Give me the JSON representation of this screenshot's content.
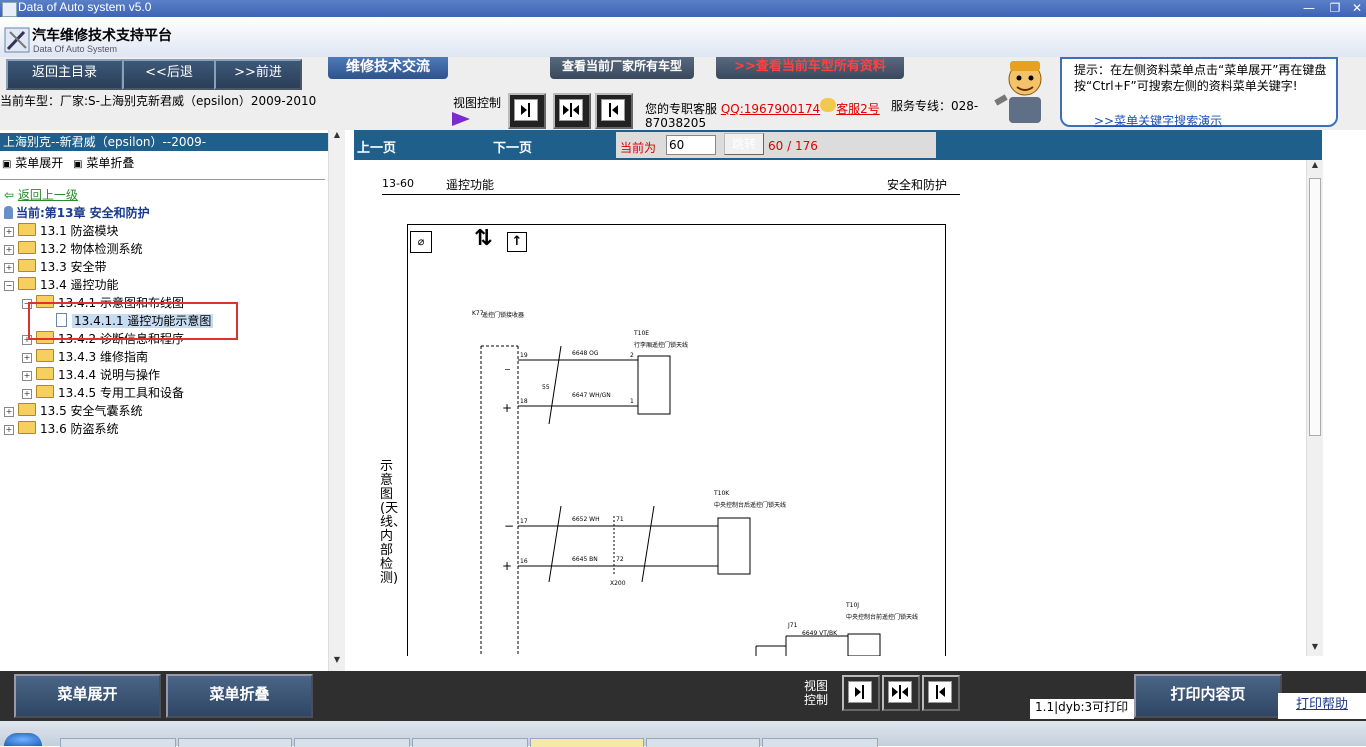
{
  "window": {
    "title": "Data of Auto system v5.0"
  },
  "header": {
    "title": "汽车维修技术支持平台",
    "subtitle": "Data Of Auto System"
  },
  "nav": {
    "back_home": "返回主目录",
    "back": "<<后退",
    "forward": ">>前进",
    "tech_exchange": "维修技术交流",
    "view_brand_models": "查看当前厂家所有车型",
    "view_model_data": ">>查看当前车型所有资料",
    "current_model": "当前车型：厂家:S-上海别克新君威（epsilon）2009-2010",
    "view_control": "视图控制",
    "service_label": "您的专职客服",
    "qq": "QQ:1967900174",
    "service2": "客服2号",
    "hotline": "服务专线：028-87038205",
    "tip": "提示：在左侧资料菜单点击“菜单展开”再在键盘按“Ctrl+F”可搜索左侧的资料菜单关键字!",
    "tip_link": ">>菜单关键字搜索演示"
  },
  "left": {
    "header": "上海别克--新君威（epsilon）--2009-",
    "expand": "菜单展开",
    "collapse": "菜单折叠",
    "back_up": "返回上一级",
    "current": "当前:第13章 安全和防护",
    "tree": [
      {
        "label": "13.1 防盗模块",
        "indent": 0
      },
      {
        "label": "13.2 物体检测系统",
        "indent": 0
      },
      {
        "label": "13.3 安全带",
        "indent": 0
      },
      {
        "label": "13.4 遥控功能",
        "indent": 0
      },
      {
        "label": "13.4.1 示意图和布线图",
        "indent": 1
      },
      {
        "label": "13.4.1.1 遥控功能示意图",
        "indent": 2
      },
      {
        "label": "13.4.2 诊断信息和程序",
        "indent": 1
      },
      {
        "label": "13.4.3 维修指南",
        "indent": 1
      },
      {
        "label": "13.4.4 说明与操作",
        "indent": 1
      },
      {
        "label": "13.4.5 专用工具和设备",
        "indent": 1
      },
      {
        "label": "13.5 安全气囊系统",
        "indent": 0
      },
      {
        "label": "13.6 防盗系统",
        "indent": 0
      }
    ]
  },
  "main": {
    "prev": "上一页",
    "next": "下一页",
    "current_label": "当前为",
    "page_value": "60",
    "jump": "跳转",
    "page_count": "60 / 176",
    "doc_page": "13-60",
    "doc_section": "遥控功能",
    "doc_chapter": "安全和防护",
    "doc_side_title": "示意图(天线、内部检测)",
    "diagram": {
      "conn_top": "K77",
      "conn_top_desc": "遥控门锁接收器",
      "t10e": "T10E",
      "t10e_desc": "行李厢遥控门锁天线",
      "t10k": "T10K",
      "t10k_desc": "中央控制台后遥控门锁天线",
      "t10j": "T10J",
      "t10j_desc": "中央控制台前遥控门锁天线",
      "j71": "J71",
      "x200": "X200",
      "w1": "6648 OG",
      "w2": "6647 WH/GN",
      "w3": "6652 WH",
      "w4": "6645 BN",
      "w5": "6649 VT/BK",
      "n55": "55",
      "n19": "19",
      "n18": "18",
      "n17": "17",
      "n16": "16",
      "n71": "71",
      "n72": "72",
      "p1": "1",
      "p2": "2"
    }
  },
  "bottom": {
    "expand": "菜单展开",
    "collapse": "菜单折叠",
    "view_control_1": "视图",
    "view_control_2": "控制",
    "status": "1.1|dyb:3可打印",
    "print": "打印内容页",
    "print_help": "打印帮助"
  },
  "colors": {
    "blue_bar": "#1f5f8c",
    "accent_red": "#e00000",
    "selection": "#c6dcf2"
  }
}
